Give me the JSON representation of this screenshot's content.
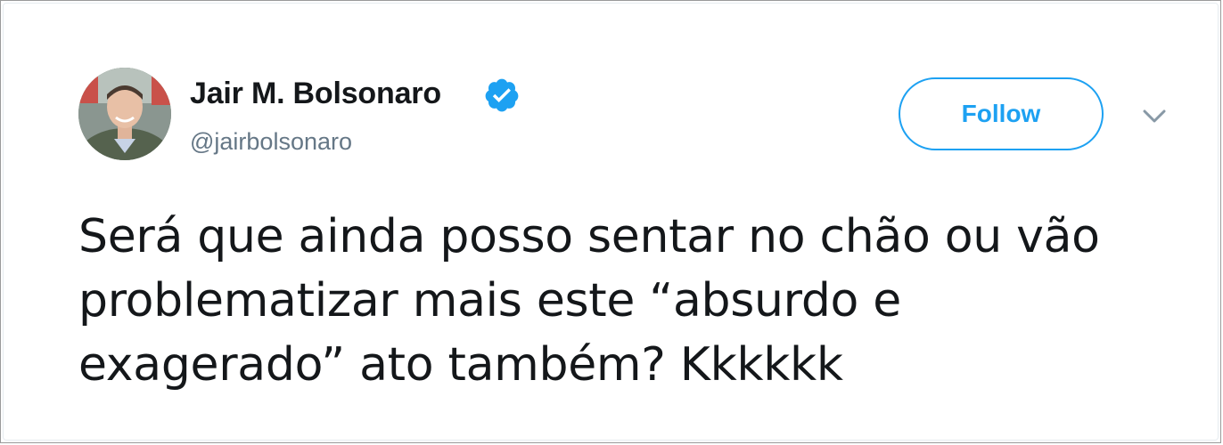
{
  "tweet": {
    "author": {
      "display_name": "Jair M. Bolsonaro",
      "handle": "@jairbolsonaro",
      "verified": true,
      "avatar_icon": "profile-photo"
    },
    "follow_label": "Follow",
    "menu_icon": "chevron-down-icon",
    "text": "Será que ainda posso sentar no chão ou vão problematizar mais este “absurdo e exagerado” ato também? Kkkkkk"
  },
  "colors": {
    "accent": "#1da1f2",
    "text": "#14171a",
    "secondary_text": "#657786",
    "caret": "#8899a6"
  }
}
